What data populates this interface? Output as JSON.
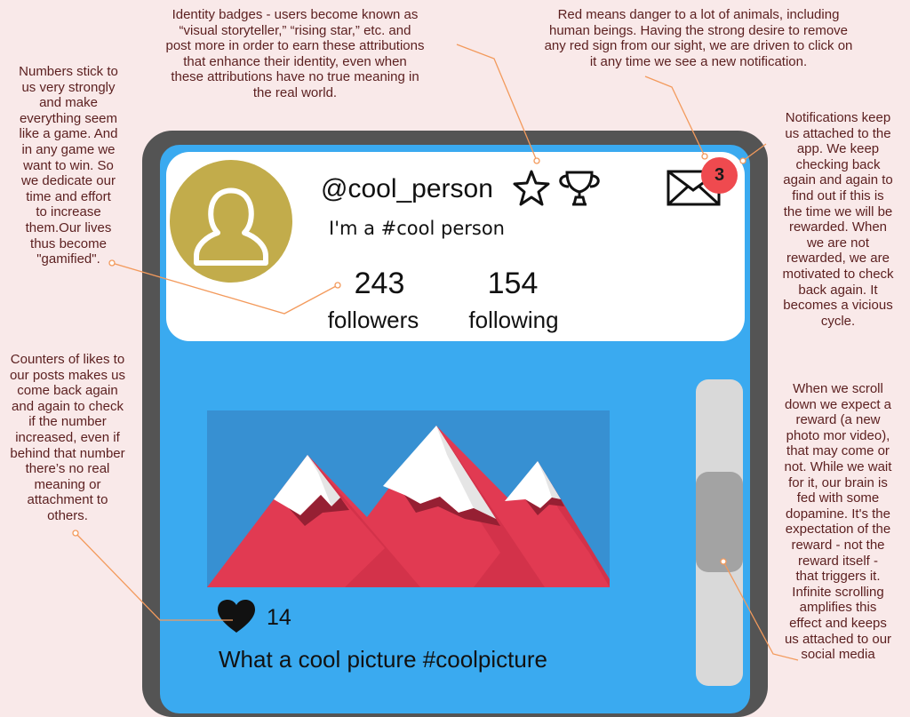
{
  "annotations": {
    "identity_badges": "Identity badges - users become known as\n“visual storyteller,” “rising star,” etc. and\npost more in order to earn these attributions\nthat enhance their identity, even when\nthese attributions have no true meaning in\nthe real world.",
    "red_danger": "Red means danger to a lot of animals, including\nhuman beings. Having the strong desire to remove\nany red sign from our sight, we are driven to click on\nit any time we see a new notification.",
    "numbers": "Numbers stick to\nus very strongly\nand make\neverything seem\nlike a game. And\nin any game we\nwant to win. So\nwe dedicate our\ntime and effort\nto increase\nthem.Our lives\nthus become\n\"gamified\".",
    "likes_counter": "Counters of likes to\nour posts makes us\ncome back again\nand again to check\nif the number\nincreased, even if\nbehind that number\nthere’s no real\nmeaning or\nattachment to\nothers.",
    "notifications": "Notifications keep\nus attached to the\napp. We keep\nchecking back\nagain and again to\nfind out if this is\nthe time we will be\nrewarded. When\nwe are not\nrewarded, we are\nmotivated to check\nback again. It\nbecomes a vicious\ncycle.",
    "scrolling": "When we scroll\ndown we expect a\nreward (a new\nphoto mor video),\nthat may come  or\nnot. While we wait\nfor it, our brain is\nfed with some\ndopamine. It's the\nexpectation of the\nreward - not the\nreward itself -\nthat triggers it.\nInfinite scrolling\namplifies this\neffect and keeps\nus attached to our\nsocial media"
  },
  "profile": {
    "username": "@cool_person",
    "bio": "I'm a #cool person",
    "followers_count": "243",
    "followers_label": "followers",
    "following_count": "154",
    "following_label": "following"
  },
  "notification_badge": "3",
  "post": {
    "likes": "14",
    "caption": "What a cool picture #coolpicture"
  },
  "icons": {
    "badge_star": "star-icon",
    "badge_trophy": "trophy-icon",
    "notifications": "envelope-icon",
    "like": "heart-icon",
    "avatar": "user-silhouette-icon"
  },
  "colors": {
    "background": "#f9e9e9",
    "screen": "#3aaaf0",
    "frame": "#545454",
    "avatar": "#c2ac4b",
    "notification_badge": "#ef4a4f",
    "mountains": "#e13a52",
    "leader_lines": "#f39a5c"
  }
}
